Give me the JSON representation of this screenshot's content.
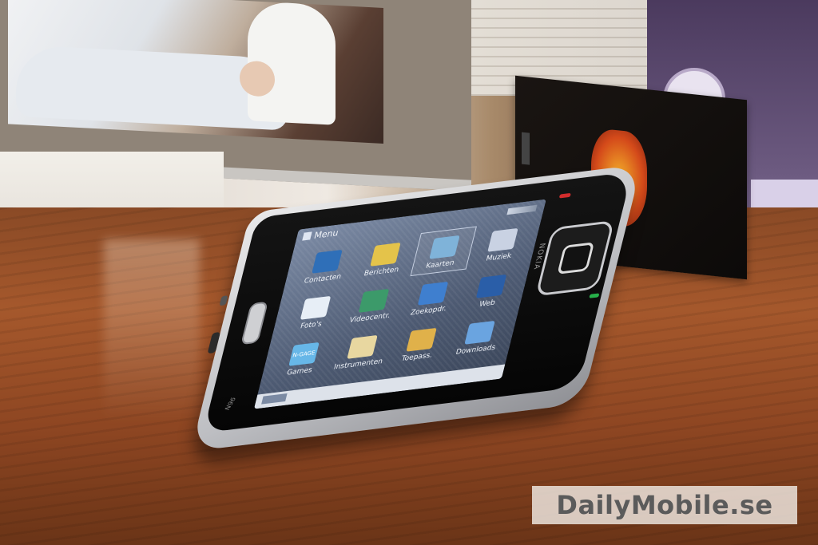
{
  "phone": {
    "menu_title": "Menu",
    "menu_items": [
      {
        "label": "Contacten",
        "icon": "contacts-icon",
        "color": "#2f6fb8"
      },
      {
        "label": "Berichten",
        "icon": "messages-icon",
        "color": "#e4c34a"
      },
      {
        "label": "Kaarten",
        "icon": "maps-icon",
        "color": "#7fb3d9",
        "selected": true
      },
      {
        "label": "Muziek",
        "icon": "music-icon",
        "color": "#c9d2e3"
      },
      {
        "label": "Foto's",
        "icon": "photos-icon",
        "color": "#e7eef6"
      },
      {
        "label": "Videocentr.",
        "icon": "video-centre-icon",
        "color": "#3c9a6a"
      },
      {
        "label": "Zoekopdr.",
        "icon": "search-icon",
        "color": "#3f7fcf"
      },
      {
        "label": "Web",
        "icon": "web-globe-icon",
        "color": "#2a5ea8"
      },
      {
        "label": "Games",
        "icon": "games-icon",
        "color": "#67b7e8",
        "tile_text": "N-GAGE"
      },
      {
        "label": "Instrumenten",
        "icon": "tools-icon",
        "color": "#e8d7a0"
      },
      {
        "label": "Toepass.",
        "icon": "apps-folder-icon",
        "color": "#e0b14a"
      },
      {
        "label": "Downloads",
        "icon": "downloads-icon",
        "color": "#6aa4e0"
      }
    ],
    "brand": "NOKIA",
    "model": "N96"
  },
  "watermark": "DailyMobile.se"
}
